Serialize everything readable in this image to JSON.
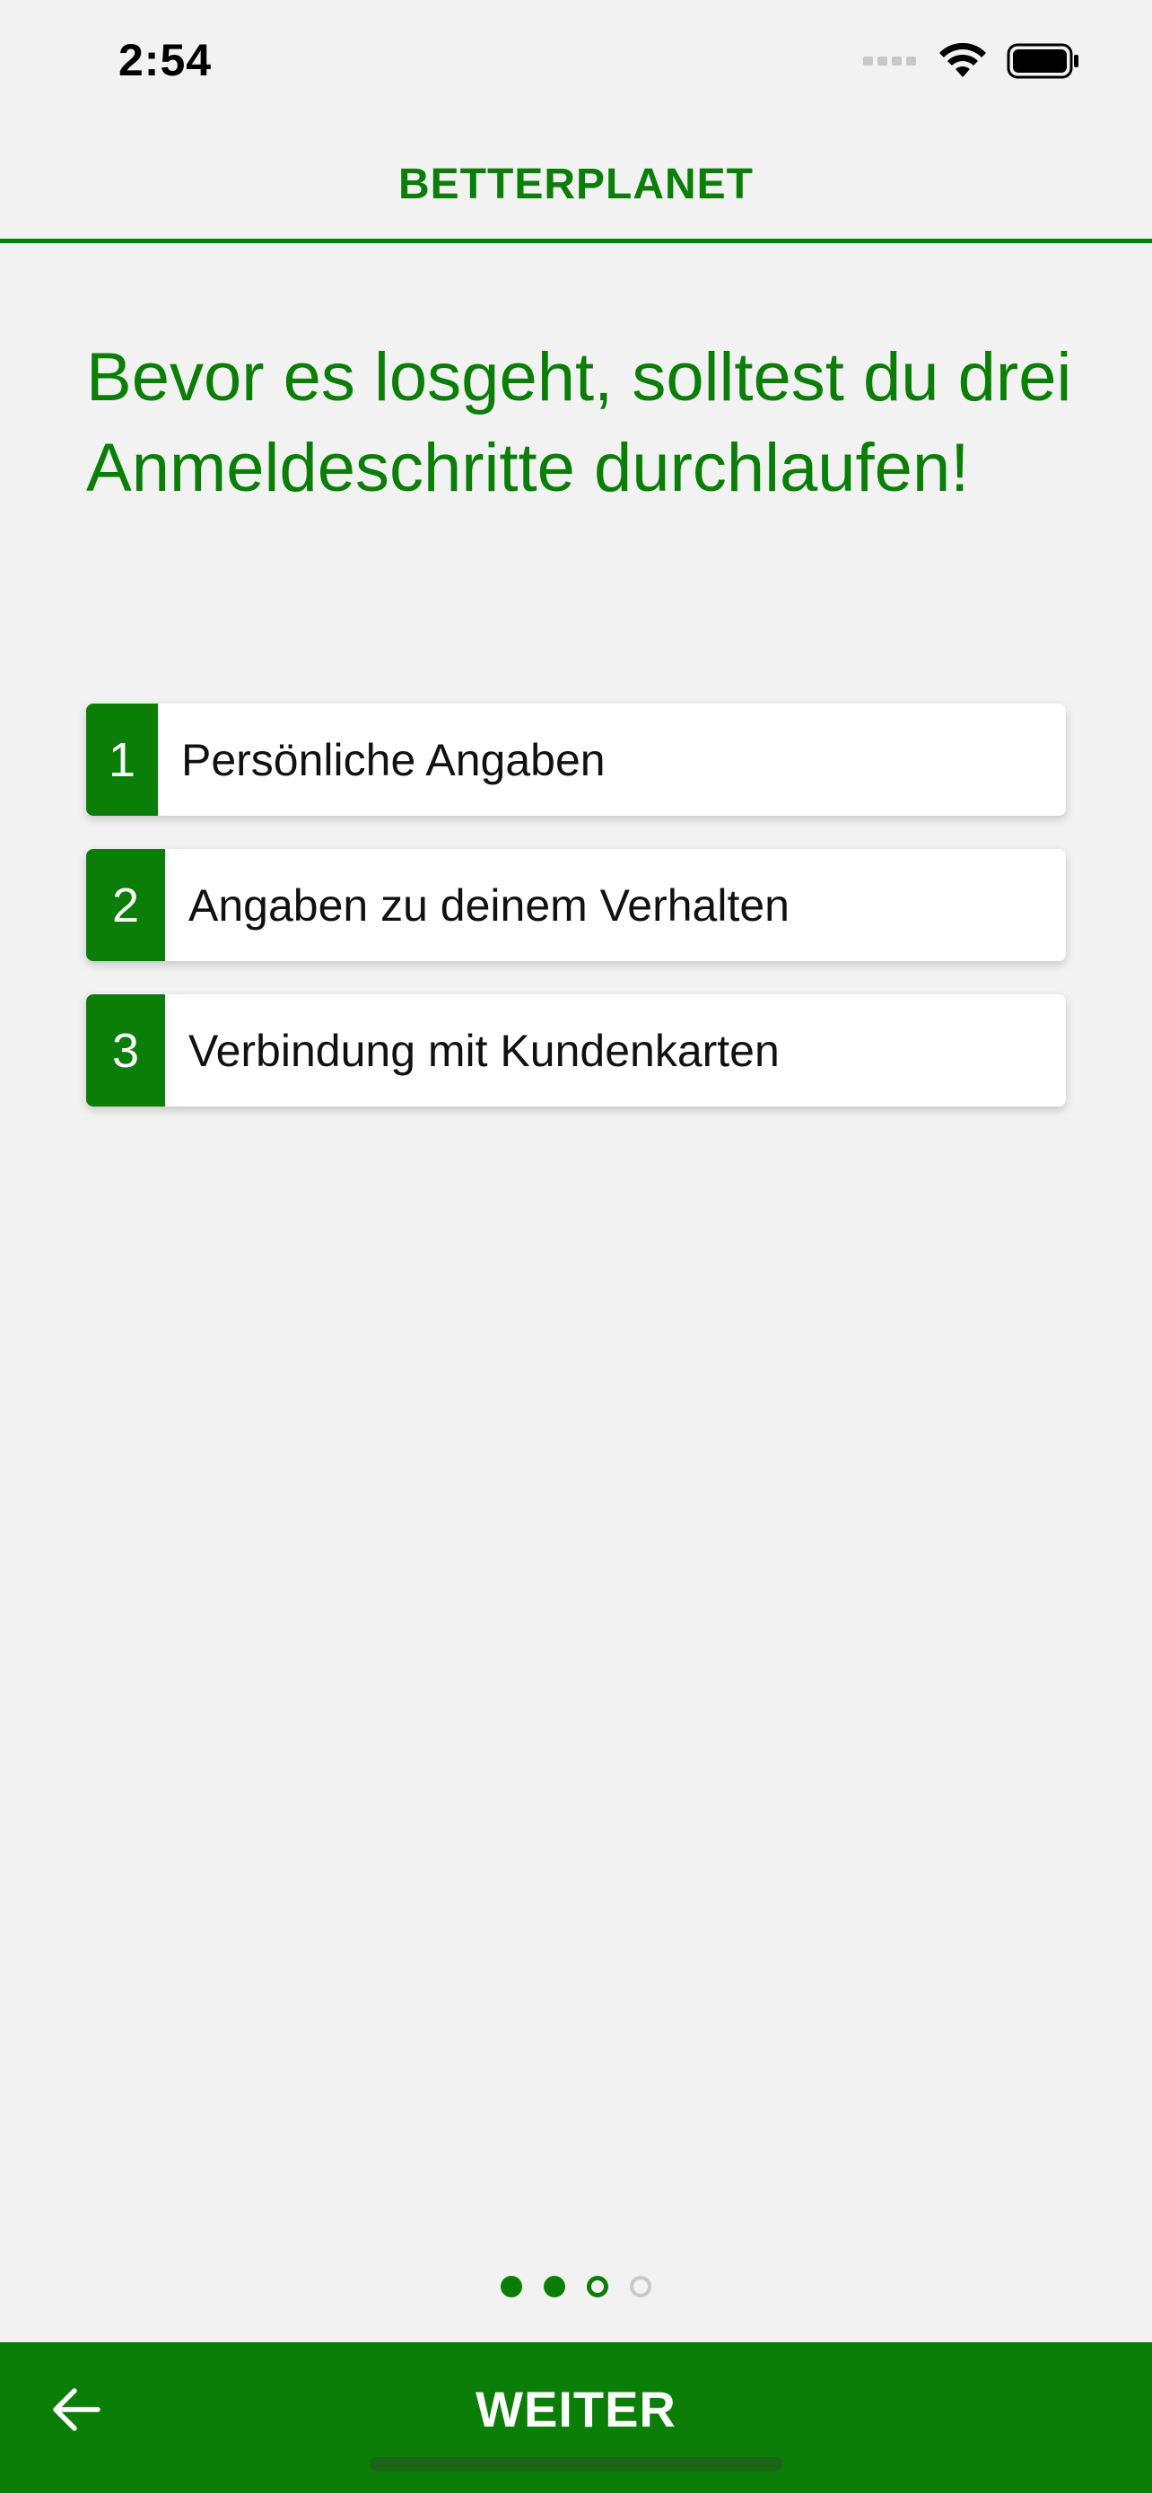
{
  "status_bar": {
    "time": "2:54",
    "icons": [
      "cellular-icon",
      "wifi-icon",
      "battery-icon"
    ]
  },
  "nav": {
    "title": "BETTERPLANET"
  },
  "intro": {
    "headline": "Bevor es losgeht, solltest du drei Anmeldeschritte durchlaufen!"
  },
  "steps": [
    {
      "number": "1",
      "label": "Persönliche Angaben"
    },
    {
      "number": "2",
      "label": "Angaben zu deinem Verhalten"
    },
    {
      "number": "3",
      "label": "Verbindung mit Kundenkarten"
    }
  ],
  "pager": {
    "total": 4,
    "current": 3
  },
  "footer": {
    "back_icon": "arrow-left-icon",
    "next_label": "WEITER"
  },
  "colors": {
    "accent": "#0a7e07",
    "background": "#f2f2f2",
    "card": "#ffffff"
  }
}
